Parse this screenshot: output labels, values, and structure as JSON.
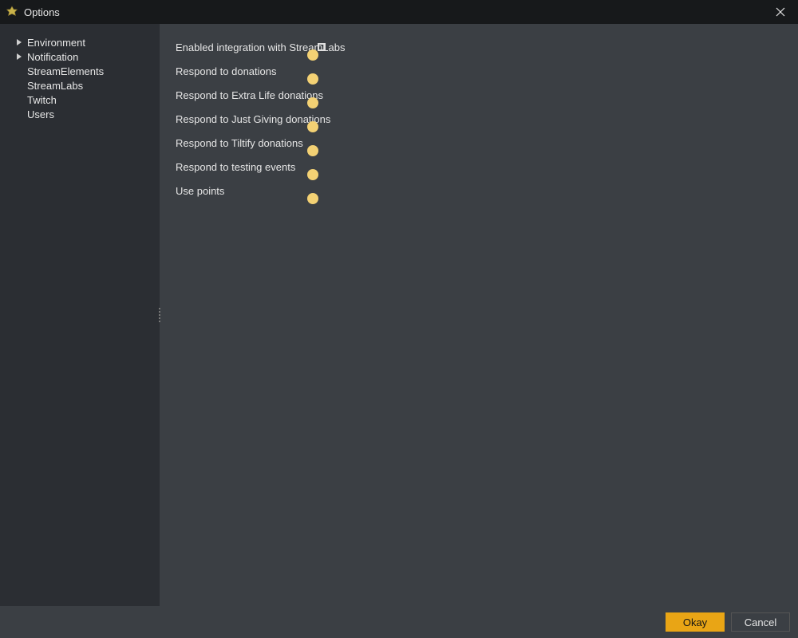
{
  "window": {
    "title": "Options"
  },
  "sidebar": {
    "items": [
      {
        "label": "Environment",
        "expandable": true
      },
      {
        "label": "Notification",
        "expandable": true
      },
      {
        "label": "StreamElements",
        "expandable": false
      },
      {
        "label": "StreamLabs",
        "expandable": false
      },
      {
        "label": "Twitch",
        "expandable": false
      },
      {
        "label": "Users",
        "expandable": false
      }
    ]
  },
  "settings": [
    {
      "label": "Enabled integration with StreamLabs",
      "value": true,
      "highlight": true
    },
    {
      "label": "Respond to donations",
      "value": true,
      "highlight": false
    },
    {
      "label": "Respond to Extra Life donations",
      "value": true,
      "highlight": false
    },
    {
      "label": "Respond to Just Giving donations",
      "value": true,
      "highlight": false
    },
    {
      "label": "Respond to Tiltify donations",
      "value": true,
      "highlight": false
    },
    {
      "label": "Respond to testing events",
      "value": true,
      "highlight": false
    },
    {
      "label": "Use points",
      "value": true,
      "highlight": false
    }
  ],
  "footer": {
    "okay_label": "Okay",
    "cancel_label": "Cancel"
  },
  "colors": {
    "accent": "#e9a515"
  }
}
